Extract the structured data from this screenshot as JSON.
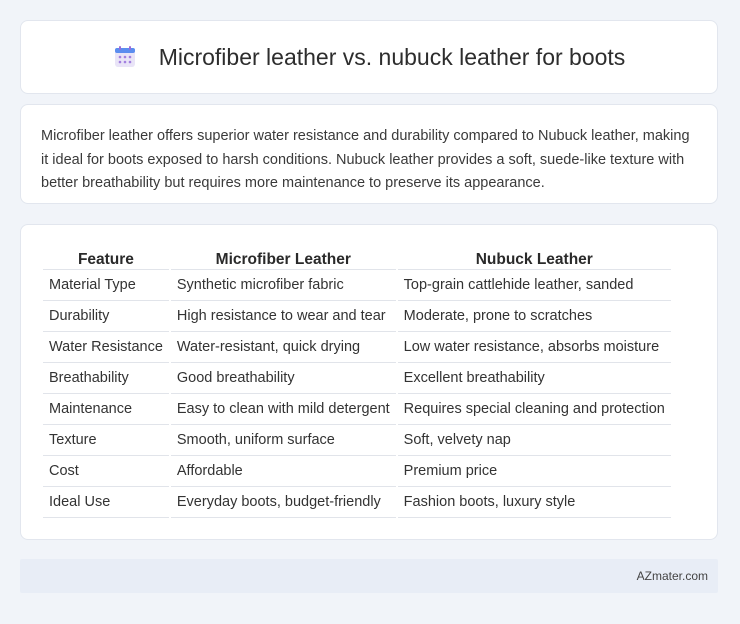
{
  "page": {
    "title": "Microfiber leather vs. nubuck leather for boots",
    "title_icon": "calendar-icon"
  },
  "summary": {
    "text": "Microfiber leather offers superior water resistance and durability compared to Nubuck leather, making it ideal for boots exposed to harsh conditions. Nubuck leather provides a soft, suede-like texture with better breathability but requires more maintenance to preserve its appearance."
  },
  "table": {
    "headers": [
      "Feature",
      "Microfiber Leather",
      "Nubuck Leather"
    ],
    "rows": [
      [
        "Material Type",
        "Synthetic microfiber fabric",
        "Top-grain cattlehide leather, sanded"
      ],
      [
        "Durability",
        "High resistance to wear and tear",
        "Moderate, prone to scratches"
      ],
      [
        "Water Resistance",
        "Water-resistant, quick drying",
        "Low water resistance, absorbs moisture"
      ],
      [
        "Breathability",
        "Good breathability",
        "Excellent breathability"
      ],
      [
        "Maintenance",
        "Easy to clean with mild detergent",
        "Requires special cleaning and protection"
      ],
      [
        "Texture",
        "Smooth, uniform surface",
        "Soft, velvety nap"
      ],
      [
        "Cost",
        "Affordable",
        "Premium price"
      ],
      [
        "Ideal Use",
        "Everyday boots, budget-friendly",
        "Fashion boots, luxury style"
      ]
    ]
  },
  "footer": {
    "site": "AZmater.com"
  },
  "colors": {
    "page_bg": "#f1f4f9",
    "card_bg": "#ffffff",
    "footer_bg": "#e8edf6",
    "icon_blue": "#5b8def",
    "icon_purple": "#9b6cd8"
  }
}
